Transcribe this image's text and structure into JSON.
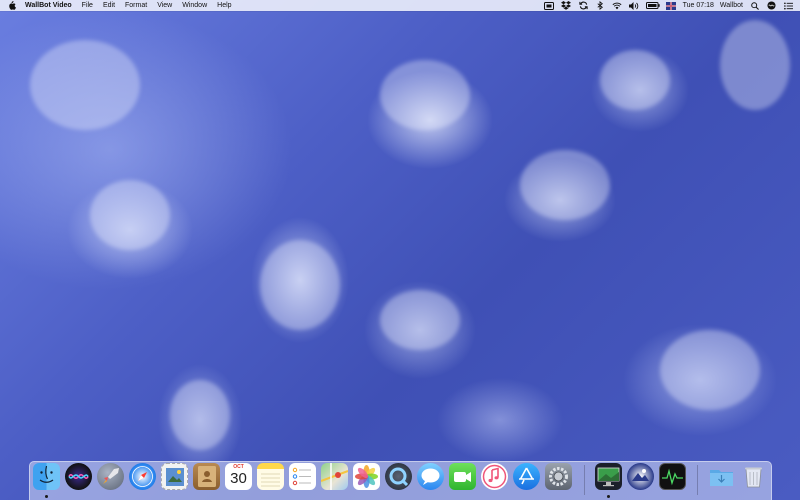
{
  "menubar": {
    "app_name": "WallBot Video",
    "menus": [
      "File",
      "Edit",
      "Format",
      "View",
      "Window",
      "Help"
    ],
    "clock": "Tue 07:18",
    "user": "Wallbot",
    "status_icons": [
      "screen-record-icon",
      "dropbox-icon",
      "sync-icon",
      "bluetooth-icon",
      "wifi-icon",
      "volume-icon",
      "battery-icon",
      "flag-icon",
      "spotlight-icon",
      "siri-icon",
      "notification-center-icon"
    ]
  },
  "dock": {
    "apps": [
      {
        "name": "finder",
        "running": true
      },
      {
        "name": "siri",
        "running": false
      },
      {
        "name": "launchpad",
        "running": false
      },
      {
        "name": "safari",
        "running": false
      },
      {
        "name": "mail",
        "running": false
      },
      {
        "name": "contacts",
        "running": false
      },
      {
        "name": "calendar",
        "running": false
      },
      {
        "name": "notes",
        "running": false
      },
      {
        "name": "reminders",
        "running": false
      },
      {
        "name": "maps",
        "running": false
      },
      {
        "name": "photos",
        "running": false
      },
      {
        "name": "quicktime",
        "running": false
      },
      {
        "name": "messages",
        "running": false
      },
      {
        "name": "facetime",
        "running": false
      },
      {
        "name": "music",
        "running": false
      },
      {
        "name": "app-store",
        "running": false
      },
      {
        "name": "system-preferences",
        "running": false
      },
      {
        "name": "wallbot-video",
        "running": true
      },
      {
        "name": "wallbot-player",
        "running": false
      },
      {
        "name": "activity-monitor",
        "running": false
      },
      {
        "name": "downloads-folder",
        "running": false
      },
      {
        "name": "trash",
        "running": false
      }
    ],
    "calendar_month": "OCT",
    "calendar_day": "30"
  }
}
